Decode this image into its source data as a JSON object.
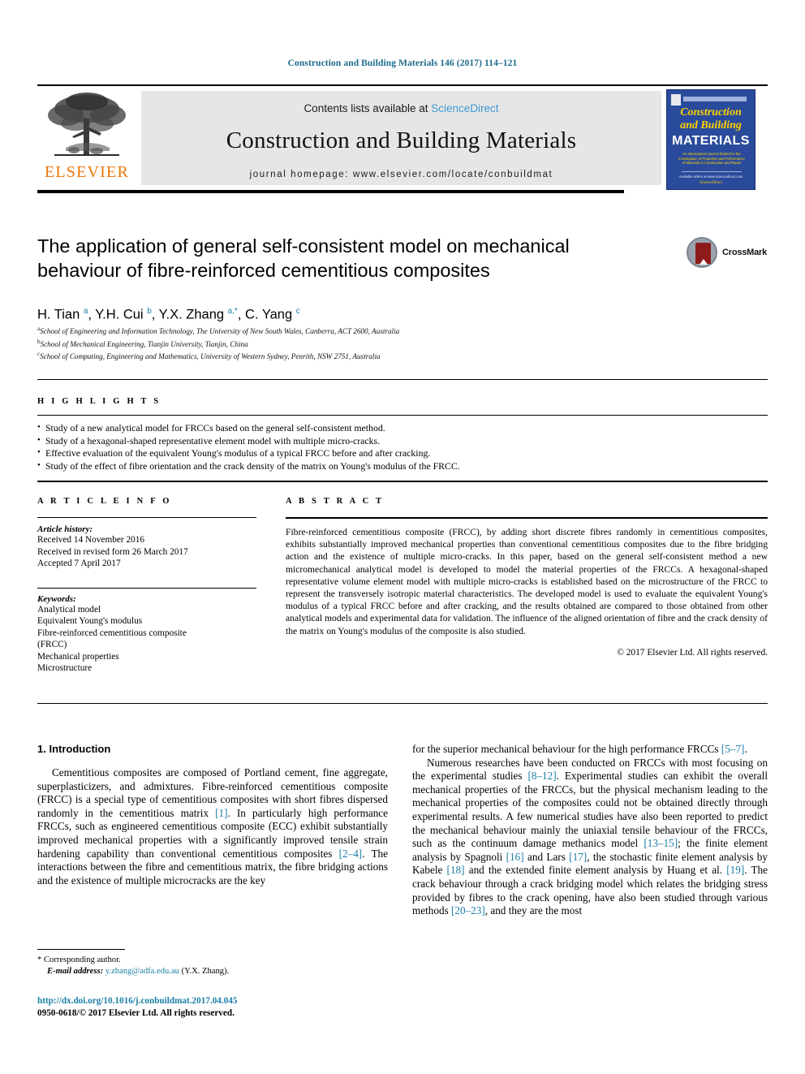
{
  "running_head": "Construction and Building Materials 146 (2017) 114–121",
  "journal_header": {
    "contents_prefix": "Contents lists available at ",
    "sciencedirect": "ScienceDirect",
    "journal_name": "Construction and Building Materials",
    "homepage": "journal homepage: www.elsevier.com/locate/conbuildmat",
    "publisher": "ELSEVIER",
    "cover": {
      "line1": "Construction",
      "line2": "and Building",
      "line3": "MATERIALS",
      "blurb": "An International Journal Related to the Investigation of Properties and Performance of Materials in Construction and Repair",
      "foot": "Available online at www.sciencedirect.com",
      "foot2": "ScienceDirect"
    }
  },
  "article": {
    "title": "The application of general self-consistent model on mechanical behaviour of fibre-reinforced cementitious composites",
    "crossmark_label": "CrossMark",
    "authors_html": "H. Tian <sup>a</sup>, Y.H. Cui <sup>b</sup>, Y.X. Zhang <sup>a,*</sup>, C. Yang <sup>c</sup>",
    "affiliations": [
      {
        "mark": "a",
        "text": "School of Engineering and Information Technology, The University of New South Wales, Canberra, ACT 2600, Australia"
      },
      {
        "mark": "b",
        "text": "School of Mechanical Engineering, Tianjin University, Tianjin, China"
      },
      {
        "mark": "c",
        "text": "School of Computing, Engineering and Mathematics, University of Western Sydney, Penrith, NSW 2751, Australia"
      }
    ]
  },
  "highlights": {
    "heading": "H I G H L I G H T S",
    "items": [
      "Study of a new analytical model for FRCCs based on the general self-consistent method.",
      "Study of a hexagonal-shaped representative element model with multiple micro-cracks.",
      "Effective evaluation of the equivalent Young's modulus of a typical FRCC before and after cracking.",
      "Study of the effect of fibre orientation and the crack density of the matrix on Young's modulus of the FRCC."
    ]
  },
  "article_info": {
    "heading": "A R T I C L E    I N F O",
    "history_label": "Article history:",
    "history": [
      "Received 14 November 2016",
      "Received in revised form 26 March 2017",
      "Accepted 7 April 2017"
    ],
    "keywords_label": "Keywords:",
    "keywords": [
      "Analytical model",
      "Equivalent Young's modulus",
      "Fibre-reinforced cementitious composite",
      "(FRCC)",
      "Mechanical properties",
      "Microstructure"
    ]
  },
  "abstract": {
    "heading": "A B S T R A C T",
    "text": "Fibre-reinforced cementitious composite (FRCC), by adding short discrete fibres randomly in cementitious composites, exhibits substantially improved mechanical properties than conventional cementitious composites due to the fibre bridging action and the existence of multiple micro-cracks. In this paper, based on the general self-consistent method a new micromechanical analytical model is developed to model the material properties of the FRCCs. A hexagonal-shaped representative volume element model with multiple micro-cracks is established based on the microstructure of the FRCC to represent the transversely isotropic material characteristics. The developed model is used to evaluate the equivalent Young's modulus of a typical FRCC before and after cracking, and the results obtained are compared to those obtained from other analytical models and experimental data for validation. The influence of the aligned orientation of fibre and the crack density of the matrix on Young's modulus of the composite is also studied.",
    "copyright": "© 2017 Elsevier Ltd. All rights reserved."
  },
  "body": {
    "section_title": "1. Introduction",
    "left_paragraphs": [
      "Cementitious composites are composed of Portland cement, fine aggregate, superplasticizers, and admixtures. Fibre-reinforced cementitious composite (FRCC) is a special type of cementitious composites with short fibres dispersed randomly in the cementitious matrix [1]. In particularly high performance FRCCs, such as engineered cementitious composite (ECC) exhibit substantially improved mechanical properties with a significantly improved tensile strain hardening capability than conventional cementitious composites [2–4]. The interactions between the fibre and cementitious matrix, the fibre bridging actions and the existence of multiple microcracks are the key"
    ],
    "right_paragraphs": [
      "for the superior mechanical behaviour for the high performance FRCCs [5–7].",
      "Numerous researches have been conducted on FRCCs with most focusing on the experimental studies [8–12]. Experimental studies can exhibit the overall mechanical properties of the FRCCs, but the physical mechanism leading to the mechanical properties of the composites could not be obtained directly through experimental results. A few numerical studies have also been reported to predict the mechanical behaviour mainly the uniaxial tensile behaviour of the FRCCs, such as the continuum damage methanics model [13–15]; the finite element analysis by Spagnoli [16] and Lars [17], the stochastic finite element analysis by Kabele [18] and the extended finite element analysis by Huang et al. [19]. The crack behaviour through a crack bridging model which relates the bridging stress provided by fibres to the crack opening, have also been studied through various methods [20–23], and they are the most"
    ],
    "inline_refs": [
      "[1]",
      "[2–4]",
      "[5–7]",
      "[8–12]",
      "[13–15]",
      "[16]",
      "[17]",
      "[18]",
      "[19]",
      "[20–23]"
    ]
  },
  "footer": {
    "corresponding_marker": "*",
    "corresponding_label": "Corresponding author.",
    "email_label": "E-mail address:",
    "email": "y.zhang@adfa.edu.au",
    "email_owner": "(Y.X. Zhang).",
    "doi": "http://dx.doi.org/10.1016/j.conbuildmat.2017.04.045",
    "issn_line": "0950-0618/© 2017 Elsevier Ltd. All rights reserved."
  },
  "colors": {
    "link": "#1b7ea6",
    "sciencedirect": "#3f97d3",
    "elsevier_orange": "#ec7404",
    "cover_blue": "#2a4b9b",
    "cover_yellow": "#ffd200"
  }
}
